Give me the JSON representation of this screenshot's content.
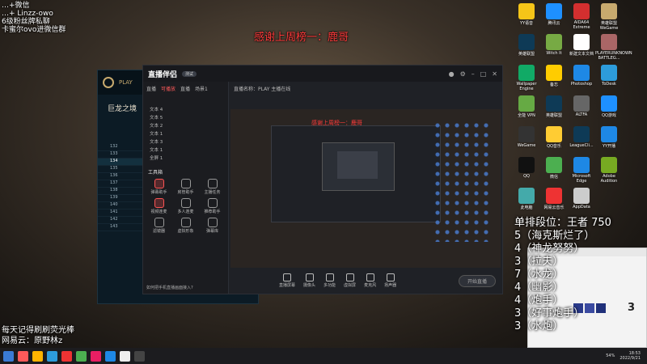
{
  "overlay_left": {
    "line1": "…+微信",
    "line2": "…+ Linzz-owo",
    "line3": "6级粉丝牌私聊",
    "line4": "卡蜜尔ovo进微信群"
  },
  "top_banner": "感谢上周榜一：鹿哥",
  "bottom_left": {
    "line1": "每天记得刷刷荧光棒",
    "line2": "网易云：原野林z"
  },
  "rank_panel": {
    "title": "单排段位：王者 750",
    "items": [
      "5（海克斯烂了）",
      "4（神龙努努）",
      "3（拉夫）",
      "7（水龙）",
      "4（幽影）",
      "4（炮手）",
      "3（好事炮手）",
      "3（水炮）"
    ]
  },
  "app": {
    "logo": "直播伴侣",
    "badge": "测试",
    "info": "直播名称：PLAY 主播在线",
    "tabs": [
      "直播",
      "可播放",
      "直播",
      "场景1"
    ],
    "sources": [
      "文本 4",
      "文本 5",
      "文本 2",
      "文本 1",
      "文本 3",
      "文本 1",
      "全屏 1"
    ],
    "tools_title": "工具箱",
    "tools": [
      "弹幕助手",
      "房管助手",
      "主播任务",
      "视频连麦",
      "多人连麦",
      "推荐助手",
      "滤镜器",
      "虚拟形象",
      "弹幕库"
    ],
    "footer_hint": "如何把手机直播画面接入?",
    "bottom_controls": [
      "直播屏幕",
      "摄像头",
      "多功能",
      "虚拟屏",
      "麦克风",
      "扬声器"
    ],
    "start_button": "开始直播",
    "preview_banner": "感谢上周榜一：鹿哥"
  },
  "lol": {
    "title": "巨龙之境",
    "rows": [
      "132",
      "133",
      "134",
      "135",
      "136",
      "137",
      "138",
      "139",
      "140",
      "141",
      "142",
      "143"
    ]
  },
  "desktop_icons": [
    "YY语音",
    "腾讯云",
    "AIDA64 Extreme",
    "英雄联盟WeGame",
    "英雄联盟",
    "Witch It",
    "新建文本文档",
    "PLAYERUNKNOWN BATTLEG...",
    "Wallpaper Engine",
    "备忘",
    "Photoshop",
    "ToDesk",
    "全能 VPN",
    "英雄联盟",
    "ALTFA",
    "QQ游戏",
    "WeGame",
    "QQ音乐",
    "LeagueCli...",
    "YY开播",
    "QQ",
    "微信",
    "Microsoft Edge",
    "Adobe Audition",
    "此电脑",
    "网易云音乐",
    "AppData"
  ],
  "chat_number": "3",
  "taskbar": {
    "battery": "54%",
    "time": "18:53",
    "date": "2022/9/21"
  }
}
